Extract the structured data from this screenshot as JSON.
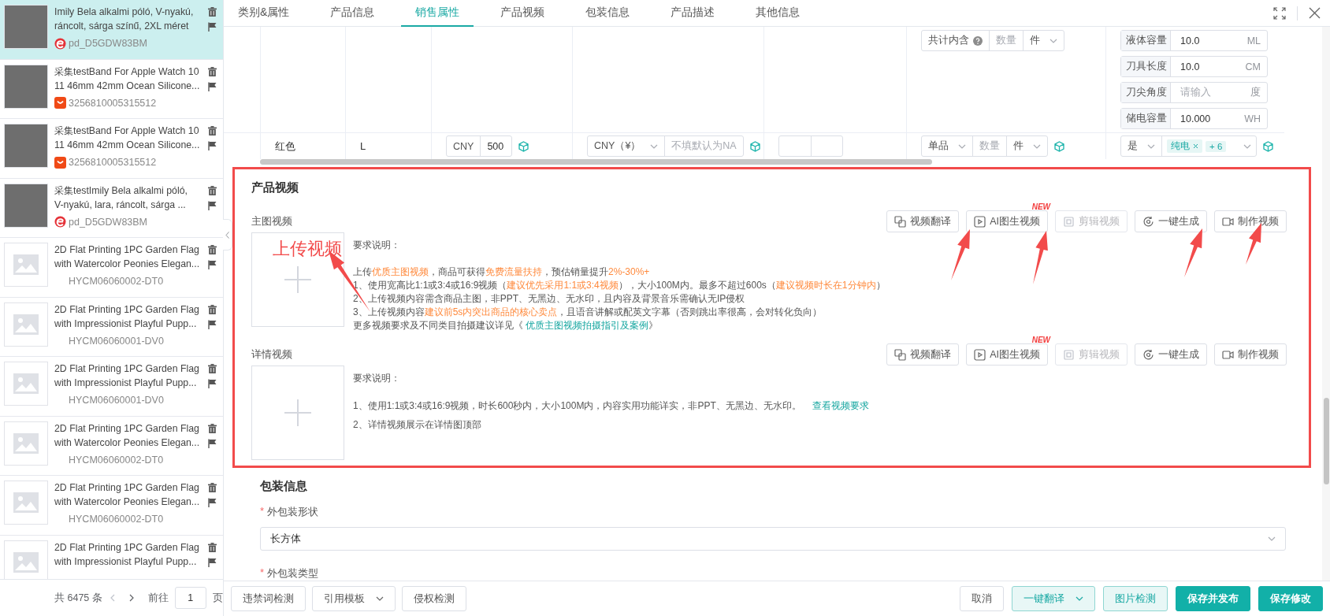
{
  "sidebar": {
    "products": [
      {
        "kind": "round-logo",
        "title_lines": [
          "Imily Bela alkalmi póló, V-nyakú,",
          "ráncolt, sárga színű, 2XL méret"
        ],
        "sku": "pd_D5GDW83BM",
        "selected": true
      },
      {
        "kind": "smile-logo",
        "title_lines": [
          "采集testBand For Apple Watch 10",
          "11 46mm 42mm Ocean Silicone..."
        ],
        "sku": "3256810005315512",
        "selected": false
      },
      {
        "kind": "smile-logo",
        "title_lines": [
          "采集testBand For Apple Watch 10",
          "11 46mm 42mm Ocean Silicone..."
        ],
        "sku": "3256810005315512",
        "selected": false
      },
      {
        "kind": "round-logo",
        "title_lines": [
          "采集testImily Bela alkalmi póló,",
          "V-nyakú, lara, ráncolt, sárga ..."
        ],
        "sku": "pd_D5GDW83BM",
        "selected": false
      },
      {
        "kind": "no-image",
        "title_lines": [
          "2D Flat Printing 1PC Garden Flag",
          "with Watercolor Peonies Elegan..."
        ],
        "sku": "HYCM06060002-DT0",
        "selected": false
      },
      {
        "kind": "no-image",
        "title_lines": [
          "2D Flat Printing 1PC Garden Flag",
          "with Impressionist Playful Pupp..."
        ],
        "sku": "HYCM06060001-DV0",
        "selected": false
      },
      {
        "kind": "no-image",
        "title_lines": [
          "2D Flat Printing 1PC Garden Flag",
          "with Impressionist Playful Pupp..."
        ],
        "sku": "HYCM06060001-DV0",
        "selected": false
      },
      {
        "kind": "no-image",
        "title_lines": [
          "2D Flat Printing 1PC Garden Flag",
          "with Watercolor Peonies Elegan..."
        ],
        "sku": "HYCM06060002-DT0",
        "selected": false
      },
      {
        "kind": "no-image",
        "title_lines": [
          "2D Flat Printing 1PC Garden Flag",
          "with Watercolor Peonies Elegan..."
        ],
        "sku": "HYCM06060002-DT0",
        "selected": false
      },
      {
        "kind": "no-image",
        "title_lines": [
          "2D Flat Printing 1PC Garden Flag",
          "with Impressionist Playful Pupp..."
        ],
        "selected": false
      }
    ],
    "pagination": {
      "total": "共 6475 条",
      "goto_label": "前往",
      "page": "1",
      "page_suffix": "页"
    }
  },
  "tabs": [
    {
      "label": "类别&属性",
      "selected": false
    },
    {
      "label": "产品信息",
      "selected": false
    },
    {
      "label": "销售属性",
      "selected": true
    },
    {
      "label": "产品视频",
      "selected": false
    },
    {
      "label": "包装信息",
      "selected": false
    },
    {
      "label": "产品描述",
      "selected": false
    },
    {
      "label": "其他信息",
      "selected": false
    }
  ],
  "variant_table": {
    "rows": [
      {
        "cells": [
          {
            "kind": "empty"
          },
          {
            "kind": "empty"
          },
          {
            "kind": "empty"
          },
          {
            "kind": "empty"
          },
          {
            "kind": "empty"
          },
          {
            "kind": "empty"
          },
          {
            "kind": "combo",
            "sync": false,
            "parts": [
              {
                "kind": "label",
                "text": "共计内含",
                "help": true
              },
              {
                "kind": "input",
                "placeholder": "数量"
              },
              {
                "kind": "select",
                "text": "件"
              }
            ]
          },
          {
            "kind": "unit_inputs",
            "items": [
              {
                "label": "液体容量",
                "value": "10.0",
                "unit": "ML"
              },
              {
                "label": "刀具长度",
                "value": "10.0",
                "unit": "CM"
              },
              {
                "label": "刀尖角度",
                "placeholder": "请输入",
                "unit": "度"
              },
              {
                "label": "储电容量",
                "value": "10.000",
                "unit": "WH"
              }
            ]
          }
        ]
      },
      {
        "cells": [
          {
            "kind": "empty"
          },
          {
            "kind": "text",
            "text": "红色"
          },
          {
            "kind": "text",
            "text": "L"
          },
          {
            "kind": "combo",
            "sync": true,
            "parts": [
              {
                "kind": "label",
                "text": "CNY",
                "help": false
              },
              {
                "kind": "input",
                "value": "500"
              }
            ]
          },
          {
            "kind": "combo",
            "sync": true,
            "parts": [
              {
                "kind": "select",
                "text": "CNY（¥）"
              },
              {
                "kind": "input",
                "placeholder": "不填默认为NA"
              }
            ]
          },
          {
            "kind": "combo",
            "sync": false,
            "parts": [
              {
                "kind": "input"
              },
              {
                "kind": "input"
              }
            ]
          },
          {
            "kind": "combo",
            "sync": true,
            "parts": [
              {
                "kind": "select",
                "text": "单品"
              },
              {
                "kind": "input",
                "placeholder": "数量"
              },
              {
                "kind": "select",
                "text": "件"
              }
            ]
          },
          {
            "kind": "combo",
            "sync": true,
            "parts": [
              {
                "kind": "select",
                "text": "是"
              },
              {
                "kind": "tags",
                "tags": [
                  "纯电"
                ],
                "more": "+ 6"
              }
            ]
          }
        ]
      }
    ]
  },
  "product_video": {
    "title": "产品视频",
    "blocks": [
      {
        "kind": "main",
        "label": "主图视频",
        "buttons": [
          {
            "kind": "translate",
            "label": "视频翻译",
            "disabled": false
          },
          {
            "kind": "ai",
            "label": "AI图生视频",
            "badge": "NEW",
            "disabled": false
          },
          {
            "kind": "edit",
            "label": "剪辑视频",
            "disabled": true
          },
          {
            "kind": "generate",
            "label": "一键生成",
            "disabled": false
          },
          {
            "kind": "camera",
            "label": "制作视频",
            "disabled": false
          }
        ],
        "requirements_title": "要求说明：",
        "lines": [
          {
            "kind": "plain",
            "text": "上传**优质主图视频**，商品可获得**免费流量扶持**，预估销量提升**2%-30%+**"
          },
          {
            "kind": "plain",
            "text": "1、使用宽高比1:1或3:4或16:9视频（**建议优先采用1:1或3:4视频**），大小100M内。最多不超过600s（**建议视频时长在1分钟内**）"
          },
          {
            "kind": "plain",
            "text": "2、上传视频内容需含商品主图，非PPT、无黑边、无水印，且内容及背景音乐需确认无IP侵权"
          },
          {
            "kind": "plain",
            "text": "3、上传视频内容**建议前5s内突出商品的核心卖点**，且语音讲解或配英文字幕（否则跳出率很高，会对转化负向）"
          },
          {
            "kind": "inline-link",
            "text": "更多视频要求及不同类目拍摄建议详见《",
            "link": "优质主图视频拍摄指引及案例",
            "suffix": "》"
          }
        ]
      },
      {
        "kind": "detail",
        "label": "详情视频",
        "buttons": [
          {
            "kind": "translate",
            "label": "视频翻译",
            "disabled": false
          },
          {
            "kind": "ai",
            "label": "AI图生视频",
            "badge": "NEW",
            "disabled": false
          },
          {
            "kind": "edit",
            "label": "剪辑视频",
            "disabled": true
          },
          {
            "kind": "generate",
            "label": "一键生成",
            "disabled": false
          },
          {
            "kind": "camera",
            "label": "制作视频",
            "disabled": false
          }
        ],
        "requirements_title": "要求说明：",
        "lines": [
          {
            "kind": "trailing-link",
            "text": "1、使用1:1或3:4或16:9视频，时长600秒内，大小100M内，内容实用功能详实，非PPT、无黑边、无水印。",
            "link": "查看视频要求"
          },
          {
            "kind": "plain",
            "text": "2、详情视频展示在详情图顶部"
          }
        ]
      }
    ]
  },
  "packaging": {
    "title": "包装信息",
    "fields": [
      {
        "required_mark": "*",
        "label": "外包装形状",
        "value": "长方体"
      },
      {
        "required_mark": "*",
        "label": "外包装类型"
      }
    ]
  },
  "footer": {
    "left_buttons": [
      {
        "label": "违禁词检测",
        "dropdown": false
      },
      {
        "label": "引用模板",
        "dropdown": true
      },
      {
        "label": "侵权检测",
        "dropdown": false
      }
    ],
    "right_buttons": [
      {
        "kind": "default",
        "label": "取消",
        "dropdown": false
      },
      {
        "kind": "light",
        "label": "一键翻译",
        "dropdown": true
      },
      {
        "kind": "light",
        "label": "图片检测",
        "dropdown": false
      },
      {
        "kind": "primary",
        "label": "保存并发布",
        "dropdown": false
      },
      {
        "kind": "primary",
        "label": "保存修改",
        "dropdown": false
      }
    ]
  },
  "annotations": {
    "label": "上传视频"
  }
}
